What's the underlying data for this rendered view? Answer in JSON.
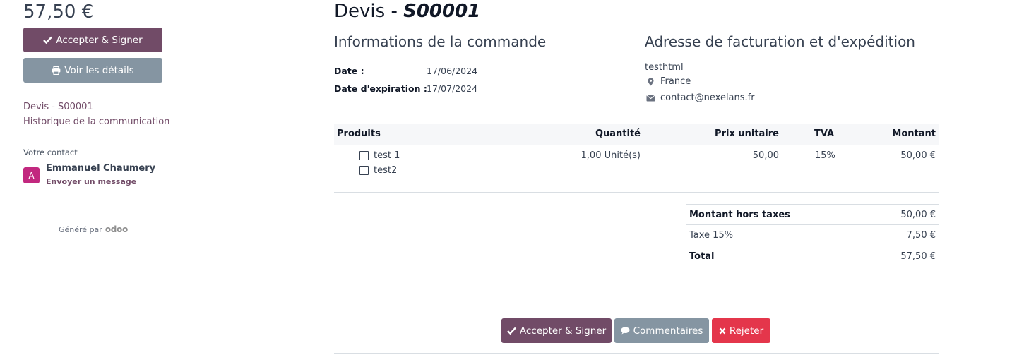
{
  "sidebar": {
    "amount": "57,50 €",
    "accept_label": "Accepter & Signer",
    "details_label": "Voir les détails",
    "nav": [
      "Devis - S00001",
      "Historique de la communication"
    ],
    "contact_title": "Votre contact",
    "contact_initial": "A",
    "contact_name": "Emmanuel Chaumery",
    "contact_message": "Envoyer un message",
    "powered_by": "Généré par",
    "powered_logo": "odoo"
  },
  "document": {
    "title_prefix": "Devis - ",
    "title_number": "S00001"
  },
  "order_info": {
    "heading": "Informations de la commande",
    "date_label": "Date :",
    "date_value": "17/06/2024",
    "expiry_label": "Date d'expiration :",
    "expiry_value": "17/07/2024"
  },
  "address": {
    "heading": "Adresse de facturation et d'expédition",
    "name": "testhtml",
    "country": "France",
    "email": "contact@nexelans.fr"
  },
  "table": {
    "headers": [
      "Produits",
      "Quantité",
      "Prix unitaire",
      "TVA",
      "Montant"
    ],
    "rows": [
      {
        "products": [
          "test 1",
          "test2"
        ],
        "quantity": "1,00 Unité(s)",
        "unit_price": "50,00",
        "tax": "15%",
        "amount": "50,00 €"
      }
    ]
  },
  "totals": [
    {
      "label": "Montant hors taxes",
      "value": "50,00 €"
    },
    {
      "label": "Taxe 15%",
      "value": "7,50 €"
    },
    {
      "label": "Total",
      "value": "57,50 €"
    }
  ],
  "actions": {
    "accept": "Accepter & Signer",
    "comments": "Commentaires",
    "reject": "Rejeter"
  },
  "colors": {
    "primary": "#714b67",
    "secondary": "#8595a2",
    "danger": "#e4364b",
    "avatar": "#c2287f"
  }
}
